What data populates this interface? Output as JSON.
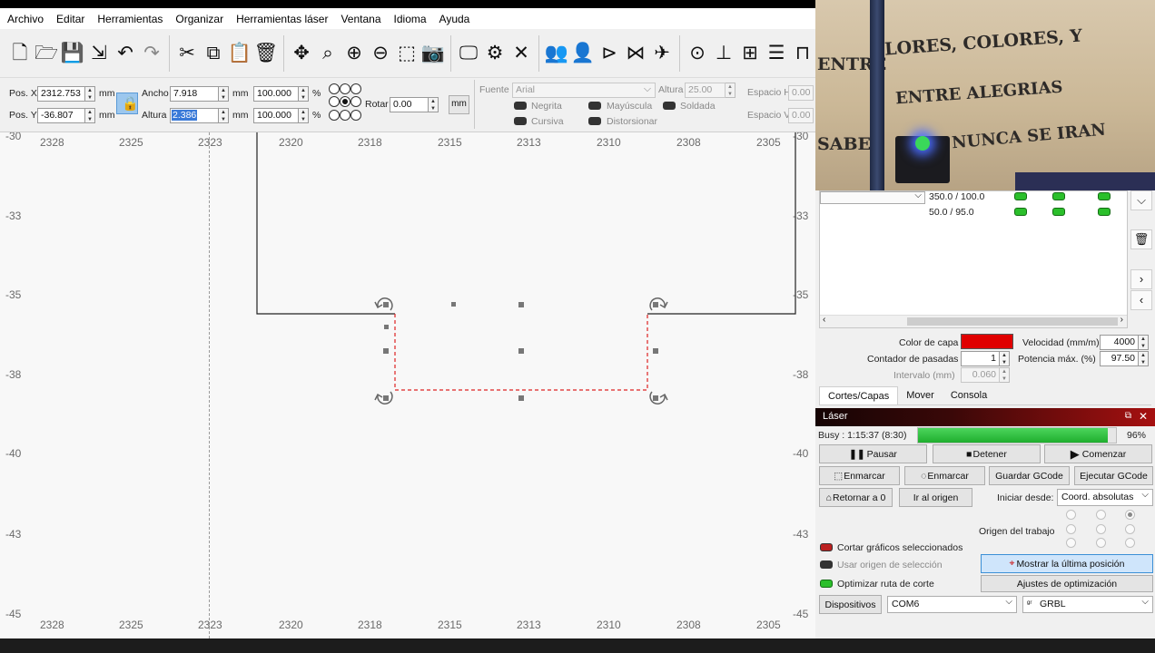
{
  "menu": [
    "Archivo",
    "Editar",
    "Herramientas",
    "Organizar",
    "Herramientas láser",
    "Ventana",
    "Idioma",
    "Ayuda"
  ],
  "props": {
    "posx_label": "Pos. X",
    "posx": "2312.753",
    "posy_label": "Pos. Y",
    "posy": "-36.807",
    "unit": "mm",
    "ancho_label": "Ancho",
    "ancho": "7.918",
    "altura_label": "Altura",
    "altura": "2.386",
    "scale_w": "100.000",
    "scale_h": "100.000",
    "pct": "%",
    "rotar_label": "Rotar",
    "rotar": "0.00",
    "mm_button": "mm",
    "fuente_label": "Fuente",
    "fuente": "Arial",
    "font_altura_label": "Altura",
    "font_altura": "25.00",
    "negrita": "Negrita",
    "mayuscula": "Mayúscula",
    "soldada": "Soldada",
    "cursiva": "Cursiva",
    "distorsionar": "Distorsionar",
    "espacio_h_label": "Espacio H",
    "espacio_h": "0.00",
    "espacio_v_label": "Espacio V",
    "espacio_v": "0.00"
  },
  "ruler": {
    "x_ticks": [
      "2328",
      "2325",
      "2323",
      "2320",
      "2318",
      "2315",
      "2313",
      "2310",
      "2308",
      "2305"
    ],
    "y_ticks": [
      "-30",
      "-33",
      "-35",
      "-38",
      "-40",
      "-43",
      "-45"
    ]
  },
  "layers": [
    {
      "speed_power": "350.0 / 100.0"
    },
    {
      "speed_power": "50.0 / 95.0"
    }
  ],
  "layer_settings": {
    "color_label": "Color de capa",
    "color": "#e00000",
    "speed_label": "Velocidad (mm/m)",
    "speed": "4000",
    "passes_label": "Contador de pasadas",
    "passes": "1",
    "power_label": "Potencia máx. (%)",
    "power": "97.50",
    "interval_label": "Intervalo (mm)",
    "interval": "0.060"
  },
  "tabs": [
    "Cortes/Capas",
    "Mover",
    "Consola"
  ],
  "laser": {
    "title": "Láser",
    "status": "Busy : 1:15:37 (8:30)",
    "progress_pct": "96%",
    "progress_value": 0.96,
    "pause": "Pausar",
    "stop": "Detener",
    "start": "Comenzar",
    "frame1": "Enmarcar",
    "frame2": "Enmarcar",
    "save_gcode": "Guardar GCode",
    "run_gcode": "Ejecutar GCode",
    "return_zero": "Retornar a 0",
    "go_origin": "Ir al origen",
    "start_from_label": "Iniciar desde:",
    "start_from": "Coord. absolutas",
    "job_origin_label": "Origen del trabajo",
    "cut_selected": "Cortar gráficos seleccionados",
    "use_selection_origin": "Usar origen de selección",
    "optimize_path": "Optimizar ruta de corte",
    "show_last_position": "Mostrar la última posición",
    "optimization_settings": "Ajustes de optimización",
    "devices": "Dispositivos",
    "port": "COM6",
    "controller": "GRBL"
  },
  "camera_text": [
    "ENTRE",
    "LORES, COLORES, Y",
    "ENTRE ALEGRIAS",
    "SABE",
    "NUNCA SE IRAN"
  ]
}
